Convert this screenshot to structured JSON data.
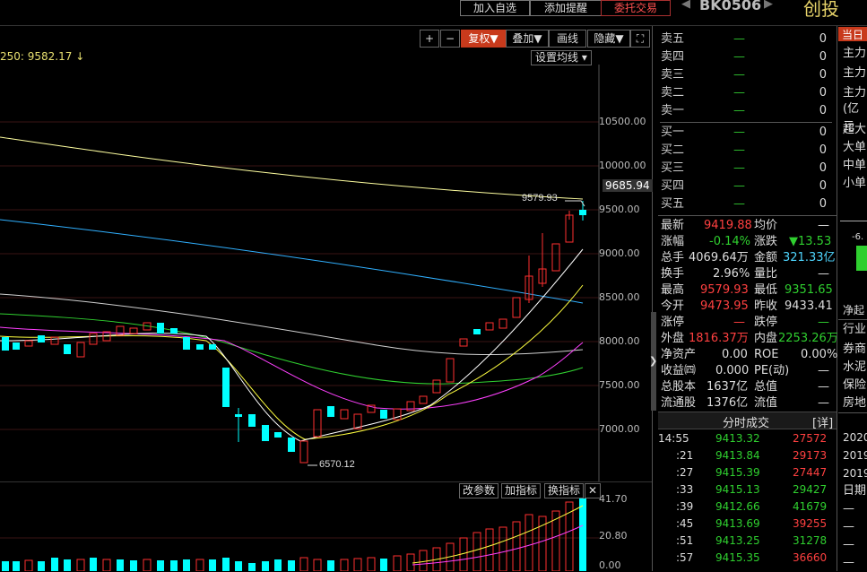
{
  "toolbar_top": {
    "add_watch": "加入自选",
    "add_alert": "添加提醒",
    "trade": "委托交易",
    "code": "BK0506",
    "name": "创投"
  },
  "chart_tools": {
    "plus": "+",
    "minus": "−",
    "restore": "复权",
    "overlay": "叠加",
    "draw": "画线",
    "hide": "隐藏",
    "fullscreen": "⛶",
    "ma_settings": "设置均线"
  },
  "ma_label": "250: 9582.17",
  "price_labels": {
    "current": "9685.94",
    "high_mark": "9579.93",
    "low_mark": "6570.12"
  },
  "y_axis_ticks": [
    "10500.00",
    "10000.00",
    "9500.00",
    "9000.00",
    "8500.00",
    "8000.00",
    "7500.00",
    "7000.00"
  ],
  "volume_axis_ticks": [
    "41.70",
    "20.80",
    "0.00"
  ],
  "sub_panel": {
    "params": "改参数",
    "add_indicator": "加指标",
    "switch_indicator": "换指标",
    "close": "✕"
  },
  "order_book": [
    {
      "label": "卖五",
      "price": "—",
      "vol": "0"
    },
    {
      "label": "卖四",
      "price": "—",
      "vol": "0"
    },
    {
      "label": "卖三",
      "price": "—",
      "vol": "0"
    },
    {
      "label": "卖二",
      "price": "—",
      "vol": "0"
    },
    {
      "label": "卖一",
      "price": "—",
      "vol": "0"
    },
    {
      "label": "买一",
      "price": "—",
      "vol": "0"
    },
    {
      "label": "买二",
      "price": "—",
      "vol": "0"
    },
    {
      "label": "买三",
      "price": "—",
      "vol": "0"
    },
    {
      "label": "买四",
      "price": "—",
      "vol": "0"
    },
    {
      "label": "买五",
      "price": "—",
      "vol": "0"
    }
  ],
  "quote": {
    "latest_label": "最新",
    "latest": "9419.88",
    "avg_label": "均价",
    "avg": "—",
    "chg_pct_label": "涨幅",
    "chg_pct": "-0.14%",
    "chg_label": "涨跌",
    "chg": "▼13.53",
    "total_vol_label": "总手",
    "total_vol": "4069.64万",
    "amount_label": "金额",
    "amount": "321.33亿",
    "turnover_label": "换手",
    "turnover": "2.96%",
    "vol_ratio_label": "量比",
    "vol_ratio": "—",
    "high_label": "最高",
    "high": "9579.93",
    "low_label": "最低",
    "low": "9351.65",
    "open_label": "今开",
    "open": "9473.95",
    "prev_close_label": "昨收",
    "prev_close": "9433.41",
    "limit_up_label": "涨停",
    "limit_up": "—",
    "limit_down_label": "跌停",
    "limit_down": "—",
    "outer_label": "外盘",
    "outer": "1816.37万",
    "inner_label": "内盘",
    "inner": "2253.26万",
    "nav_label": "净资产",
    "nav": "0.00",
    "roe_label": "ROE",
    "roe": "0.00%",
    "eps_label": "收益㈣",
    "eps": "0.000",
    "pe_label": "PE(动)",
    "pe": "—",
    "total_shares_label": "总股本",
    "total_shares": "1637亿",
    "total_value_label": "总值",
    "total_value": "—",
    "float_shares_label": "流通股",
    "float_shares": "1376亿",
    "float_value_label": "流值",
    "float_value": "—"
  },
  "ticks_header": {
    "title": "分时成交",
    "detail": "[详]"
  },
  "ticks": [
    {
      "time": "14:55",
      "price": "9413.32",
      "vol": "27572"
    },
    {
      "time": ":21",
      "price": "9413.84",
      "vol": "29173"
    },
    {
      "time": ":27",
      "price": "9415.39",
      "vol": "27447"
    },
    {
      "time": ":33",
      "price": "9415.13",
      "vol": "29427"
    },
    {
      "time": ":39",
      "price": "9412.66",
      "vol": "41679"
    },
    {
      "time": ":45",
      "price": "9413.69",
      "vol": "39255"
    },
    {
      "time": ":51",
      "price": "9413.25",
      "vol": "31278"
    },
    {
      "time": ":57",
      "price": "9415.35",
      "vol": "36660"
    }
  ],
  "side_strip": {
    "tab": "当日",
    "items": [
      "主力",
      "主力",
      "主力",
      "(亿元",
      "超大",
      "大单",
      "中单",
      "小单"
    ],
    "change": "-6.",
    "net": "净起",
    "industry": "行业",
    "sectors": [
      "券商",
      "水泥",
      "保险",
      "房地"
    ],
    "years": [
      "2020",
      "2019",
      "2019"
    ],
    "date": "日期",
    "dashes": [
      "—",
      "—",
      "—",
      "—"
    ]
  },
  "colors": {
    "up": "#ff3030",
    "down": "#00ffff",
    "ma5": "#ffffff",
    "ma10": "#ffff40",
    "ma20": "#ff40ff",
    "ma30": "#30d030",
    "ma60": "#d0d0d0",
    "ma120": "#30b0ff",
    "ma250": "#ffffa0",
    "active_button": "#c83a1c"
  }
}
